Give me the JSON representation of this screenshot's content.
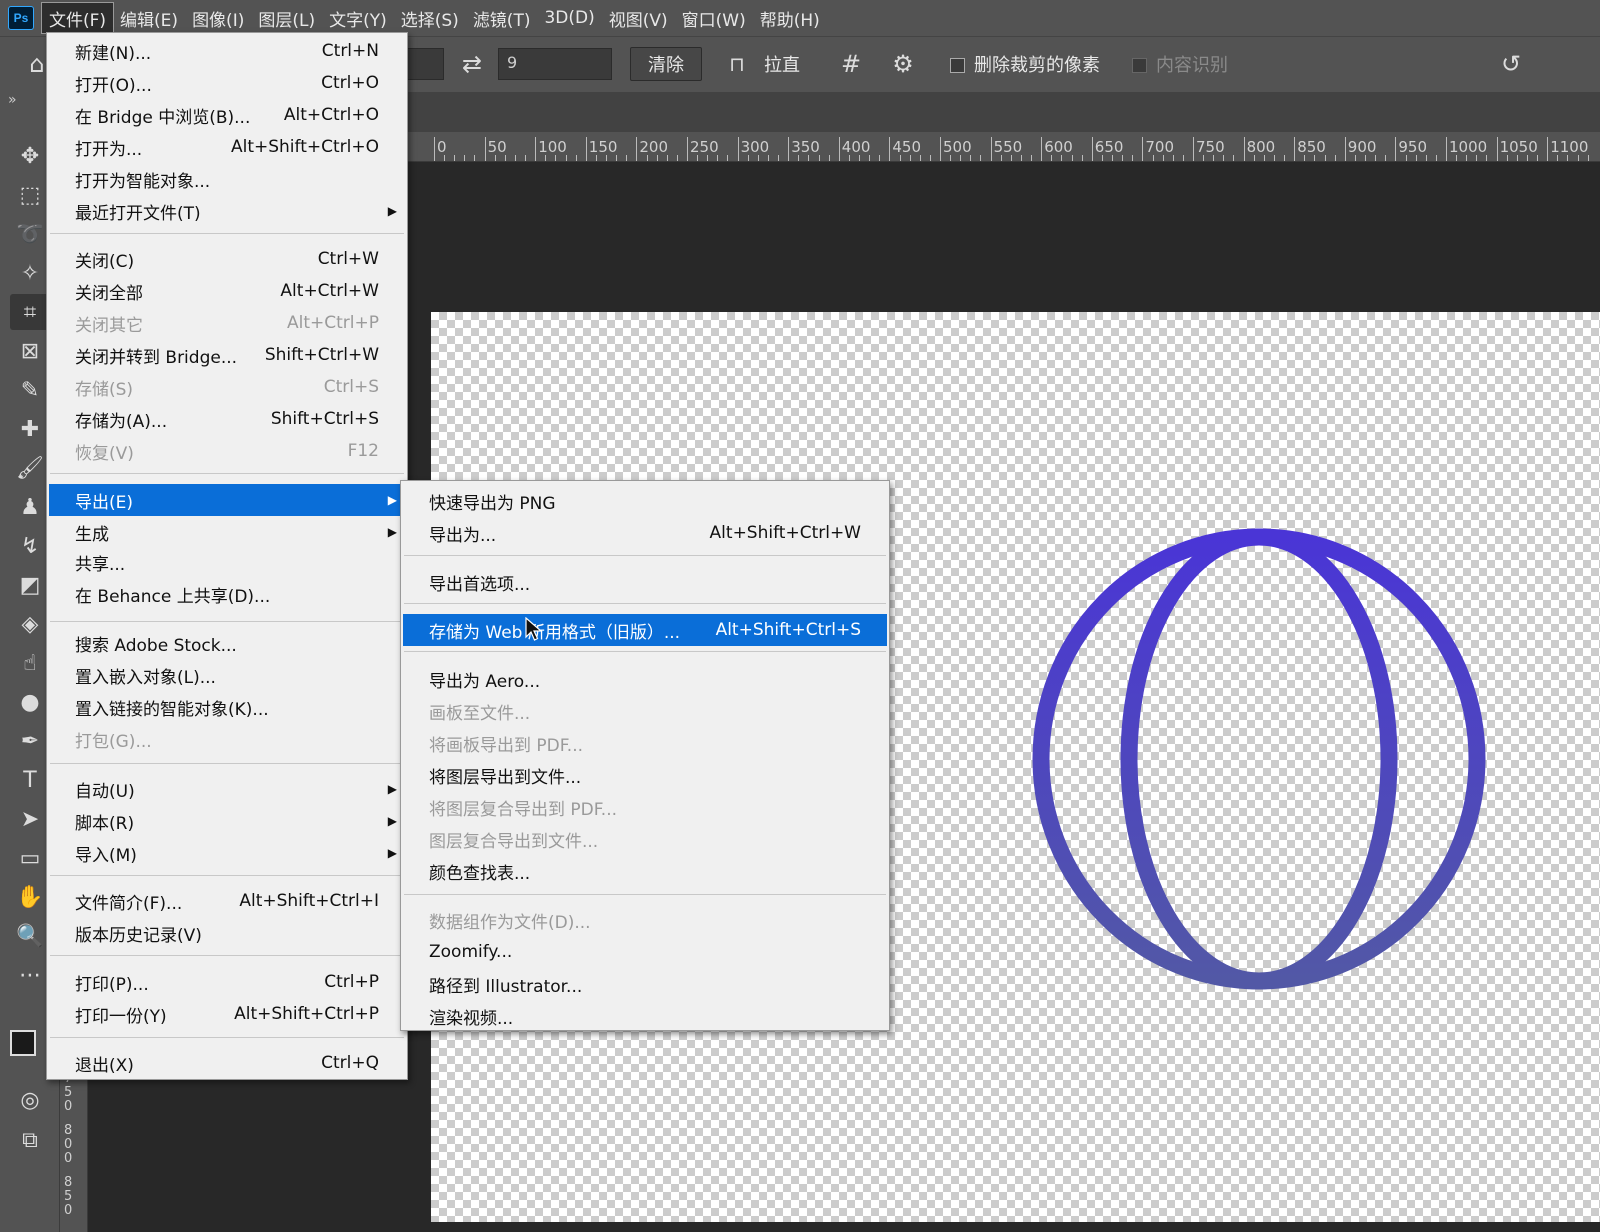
{
  "app": {
    "logo": "Ps"
  },
  "menubar": [
    "文件(F)",
    "编辑(E)",
    "图像(I)",
    "图层(L)",
    "文字(Y)",
    "选择(S)",
    "滤镜(T)",
    "3D(D)",
    "视图(V)",
    "窗口(W)",
    "帮助(H)"
  ],
  "options": {
    "swap_icon": "swap-arrows-icon",
    "ratio_value": "9",
    "clear_label": "清除",
    "straighten_label": "拉直",
    "grid_icon": "grid-overlay-icon",
    "settings_icon": "gear-icon",
    "delete_cropped_label": "删除裁剪的像素",
    "content_aware_label": "内容识别",
    "reset_icon": "reset-icon"
  },
  "ruler": {
    "labels": [
      "0",
      "50",
      "100",
      "150",
      "200",
      "250",
      "300",
      "350",
      "400",
      "450",
      "500",
      "550",
      "600",
      "650",
      "700",
      "750",
      "800",
      "850",
      "900",
      "950",
      "1000",
      "1050",
      "1100"
    ],
    "vertical_labels": [
      "750",
      "800",
      "850"
    ]
  },
  "file_menu": {
    "items": [
      {
        "label": "新建(N)...",
        "shortcut": "Ctrl+N"
      },
      {
        "label": "打开(O)...",
        "shortcut": "Ctrl+O"
      },
      {
        "label": "在 Bridge 中浏览(B)...",
        "shortcut": "Alt+Ctrl+O"
      },
      {
        "label": "打开为...",
        "shortcut": "Alt+Shift+Ctrl+O"
      },
      {
        "label": "打开为智能对象...",
        "shortcut": ""
      },
      {
        "label": "最近打开文件(T)",
        "shortcut": ""
      },
      {
        "label": "关闭(C)",
        "shortcut": "Ctrl+W"
      },
      {
        "label": "关闭全部",
        "shortcut": "Alt+Ctrl+W"
      },
      {
        "label": "关闭其它",
        "shortcut": "Alt+Ctrl+P"
      },
      {
        "label": "关闭并转到 Bridge...",
        "shortcut": "Shift+Ctrl+W"
      },
      {
        "label": "存储(S)",
        "shortcut": "Ctrl+S"
      },
      {
        "label": "存储为(A)...",
        "shortcut": "Shift+Ctrl+S"
      },
      {
        "label": "恢复(V)",
        "shortcut": "F12"
      },
      {
        "label": "导出(E)",
        "shortcut": ""
      },
      {
        "label": "生成",
        "shortcut": ""
      },
      {
        "label": "共享...",
        "shortcut": ""
      },
      {
        "label": "在 Behance 上共享(D)...",
        "shortcut": ""
      },
      {
        "label": "搜索 Adobe Stock...",
        "shortcut": ""
      },
      {
        "label": "置入嵌入对象(L)...",
        "shortcut": ""
      },
      {
        "label": "置入链接的智能对象(K)...",
        "shortcut": ""
      },
      {
        "label": "打包(G)...",
        "shortcut": ""
      },
      {
        "label": "自动(U)",
        "shortcut": ""
      },
      {
        "label": "脚本(R)",
        "shortcut": ""
      },
      {
        "label": "导入(M)",
        "shortcut": ""
      },
      {
        "label": "文件简介(F)...",
        "shortcut": "Alt+Shift+Ctrl+I"
      },
      {
        "label": "版本历史记录(V)",
        "shortcut": ""
      },
      {
        "label": "打印(P)...",
        "shortcut": "Ctrl+P"
      },
      {
        "label": "打印一份(Y)",
        "shortcut": "Alt+Shift+Ctrl+P"
      },
      {
        "label": "退出(X)",
        "shortcut": "Ctrl+Q"
      }
    ]
  },
  "export_menu": {
    "items": [
      {
        "label": "快速导出为 PNG",
        "shortcut": ""
      },
      {
        "label": "导出为...",
        "shortcut": "Alt+Shift+Ctrl+W"
      },
      {
        "label": "导出首选项...",
        "shortcut": ""
      },
      {
        "label": "存储为 Web 所用格式（旧版）...",
        "shortcut": "Alt+Shift+Ctrl+S"
      },
      {
        "label": "导出为 Aero...",
        "shortcut": ""
      },
      {
        "label": "画板至文件...",
        "shortcut": ""
      },
      {
        "label": "将画板导出到 PDF...",
        "shortcut": ""
      },
      {
        "label": "将图层导出到文件...",
        "shortcut": ""
      },
      {
        "label": "将图层复合导出到 PDF...",
        "shortcut": ""
      },
      {
        "label": "图层复合导出到文件...",
        "shortcut": ""
      },
      {
        "label": "颜色查找表...",
        "shortcut": ""
      },
      {
        "label": "数据组作为文件(D)...",
        "shortcut": ""
      },
      {
        "label": "Zoomify...",
        "shortcut": ""
      },
      {
        "label": "路径到 Illustrator...",
        "shortcut": ""
      },
      {
        "label": "渲染视频...",
        "shortcut": ""
      }
    ]
  },
  "colors": {
    "accent": "#0a6ed8",
    "globe_top": "#4a35d6",
    "globe_bottom": "#5258a6"
  }
}
